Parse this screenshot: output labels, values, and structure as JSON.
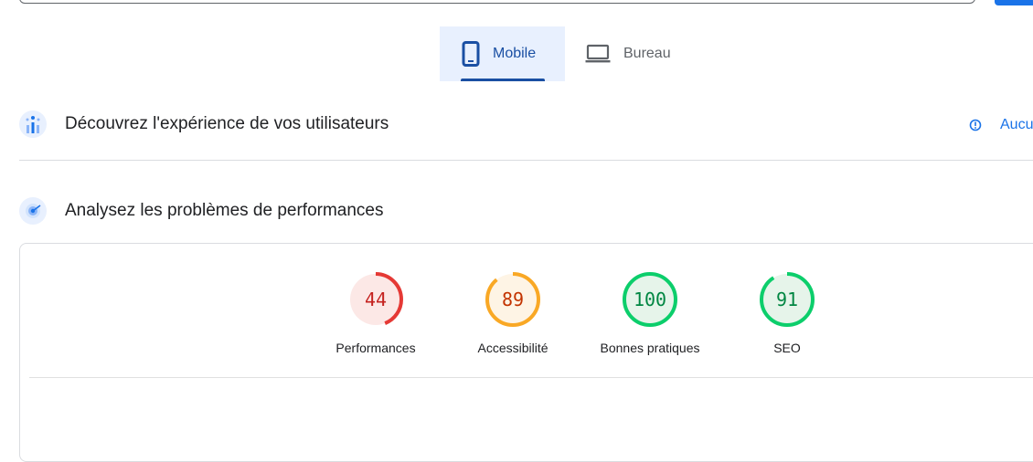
{
  "tabs": [
    {
      "label": "Mobile",
      "icon": "smartphone-icon",
      "active": true
    },
    {
      "label": "Bureau",
      "icon": "laptop-icon",
      "active": false
    }
  ],
  "sections": {
    "field": {
      "title": "Découvrez l'expérience de vos utilisateurs",
      "icon": "users-chart-icon",
      "status_label": "Aucu"
    },
    "lab": {
      "title": "Analysez les problèmes de performances",
      "icon": "target-icon"
    }
  },
  "scores": [
    {
      "label": "Performances",
      "value": "44",
      "color": "#e53935",
      "text_color": "#c5221f",
      "bg": "#fce8e6",
      "fraction": 0.44
    },
    {
      "label": "Accessibilité",
      "value": "89",
      "color": "#f9a825",
      "text_color": "#c33300",
      "bg": "#fef4e5",
      "fraction": 0.89
    },
    {
      "label": "Bonnes pratiques",
      "value": "100",
      "color": "#0cce6b",
      "text_color": "#018642",
      "bg": "#e6f4ea",
      "fraction": 1.0
    },
    {
      "label": "SEO",
      "value": "91",
      "color": "#0cce6b",
      "text_color": "#018642",
      "bg": "#e6f4ea",
      "fraction": 0.91
    }
  ],
  "colors": {
    "accent": "#1a73e8",
    "tab_active": "#1a4fa3"
  }
}
